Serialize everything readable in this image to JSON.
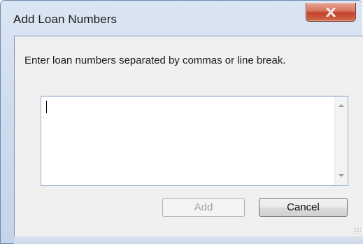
{
  "window": {
    "title": "Add Loan Numbers",
    "close_glyph": "✕"
  },
  "dialog": {
    "prompt": "Enter loan numbers separated by commas or line break.",
    "textbox": {
      "value": "",
      "placeholder": ""
    }
  },
  "buttons": {
    "add_label": "Add",
    "cancel_label": "Cancel"
  },
  "colors": {
    "title_bar": "#cfdcee",
    "client_bg": "#f0f0f0",
    "close_button": "#c4412a",
    "disabled_text": "#a0a0a0"
  },
  "icons": {
    "close": "close-icon",
    "scroll_up": "arrow-up-icon",
    "scroll_down": "arrow-down-icon",
    "resize_grip": "resize-grip-icon"
  }
}
